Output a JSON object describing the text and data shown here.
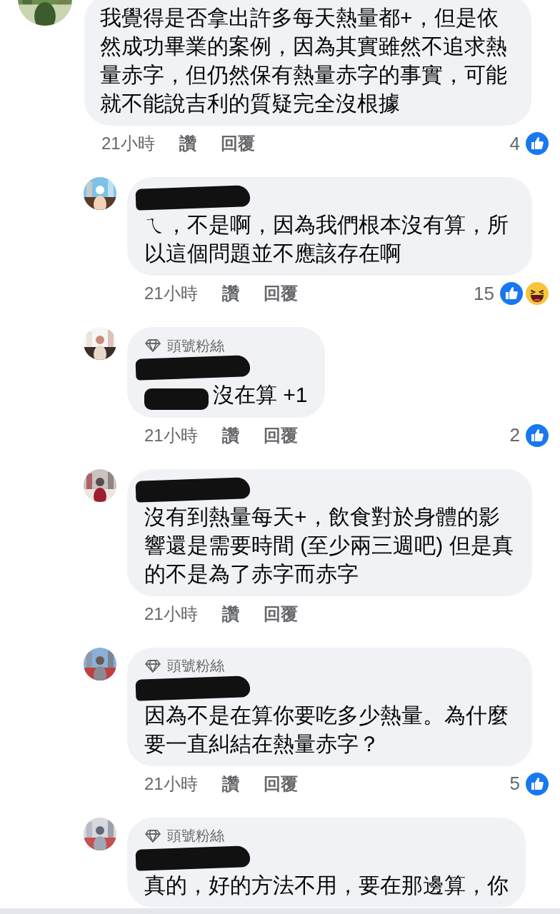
{
  "comments": [
    {
      "kind": "top",
      "text": "我覺得是否拿出許多每天熱量都+，但是依然成功畢業的案例，因為其實雖然不追求熱量赤字，但仍然保有熱量赤字的事實，可能就不能說吉利的質疑完全沒根據",
      "time": "21小時",
      "like_label": "讚",
      "reply_label": "回覆",
      "reaction_count": "4",
      "reactions": [
        {
          "kind": "like"
        }
      ]
    },
    {
      "kind": "reply",
      "redacted": true,
      "text": "ㄟ，不是啊，因為我們根本沒有算，所以這個問題並不應該存在啊",
      "time": "21小時",
      "like_label": "讚",
      "reply_label": "回覆",
      "reaction_count": "15",
      "reactions": [
        {
          "kind": "like"
        },
        {
          "kind": "haha"
        }
      ]
    },
    {
      "kind": "reply",
      "badge": "頭號粉絲",
      "redacted": true,
      "text_redacted_prefix": true,
      "text": "沒在算 +1",
      "time": "21小時",
      "like_label": "讚",
      "reply_label": "回覆",
      "reaction_count": "2",
      "reactions": [
        {
          "kind": "like"
        }
      ]
    },
    {
      "kind": "reply",
      "redacted": true,
      "text": "沒有到熱量每天+，飲食對於身體的影響還是需要時間 (至少兩三週吧) 但是真的不是為了赤字而赤字",
      "time": "21小時",
      "like_label": "讚",
      "reply_label": "回覆"
    },
    {
      "kind": "reply",
      "badge": "頭號粉絲",
      "redacted": true,
      "text": "因為不是在算你要吃多少熱量。為什麼要一直糾結在熱量赤字？",
      "time": "21小時",
      "like_label": "讚",
      "reply_label": "回覆",
      "reaction_count": "5",
      "reactions": [
        {
          "kind": "like"
        }
      ]
    },
    {
      "kind": "reply",
      "badge": "頭號粉絲",
      "redacted": true,
      "text_redacted_prefix": false,
      "text": "真的，好的方法不用，要在那邊算，你"
    }
  ]
}
